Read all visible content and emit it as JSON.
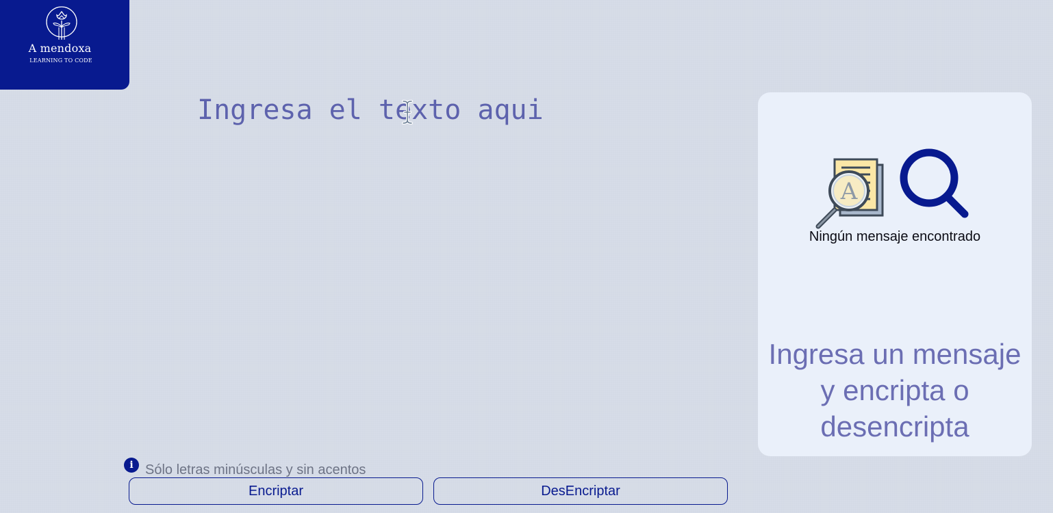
{
  "logo": {
    "name": "A mendoxa",
    "tagline": "LEARNING TO CODE"
  },
  "editor": {
    "placeholder": "Ingresa el texto aqui",
    "value": ""
  },
  "hint": {
    "icon": "info-icon",
    "icon_glyph": "i",
    "text": "Sólo letras minúsculas y sin acentos"
  },
  "actions": {
    "encrypt_label": "Encriptar",
    "decrypt_label": "DesEncriptar"
  },
  "output": {
    "empty_title": "Ningún mensaje encontrado",
    "empty_message": "Ingresa un mensaje y encripta o desencripta"
  },
  "colors": {
    "brand": "#081a8f",
    "background": "#d4dae6",
    "panel": "#eaf0fa",
    "placeholder": "#5d62ad",
    "message": "#6b6eb3"
  }
}
